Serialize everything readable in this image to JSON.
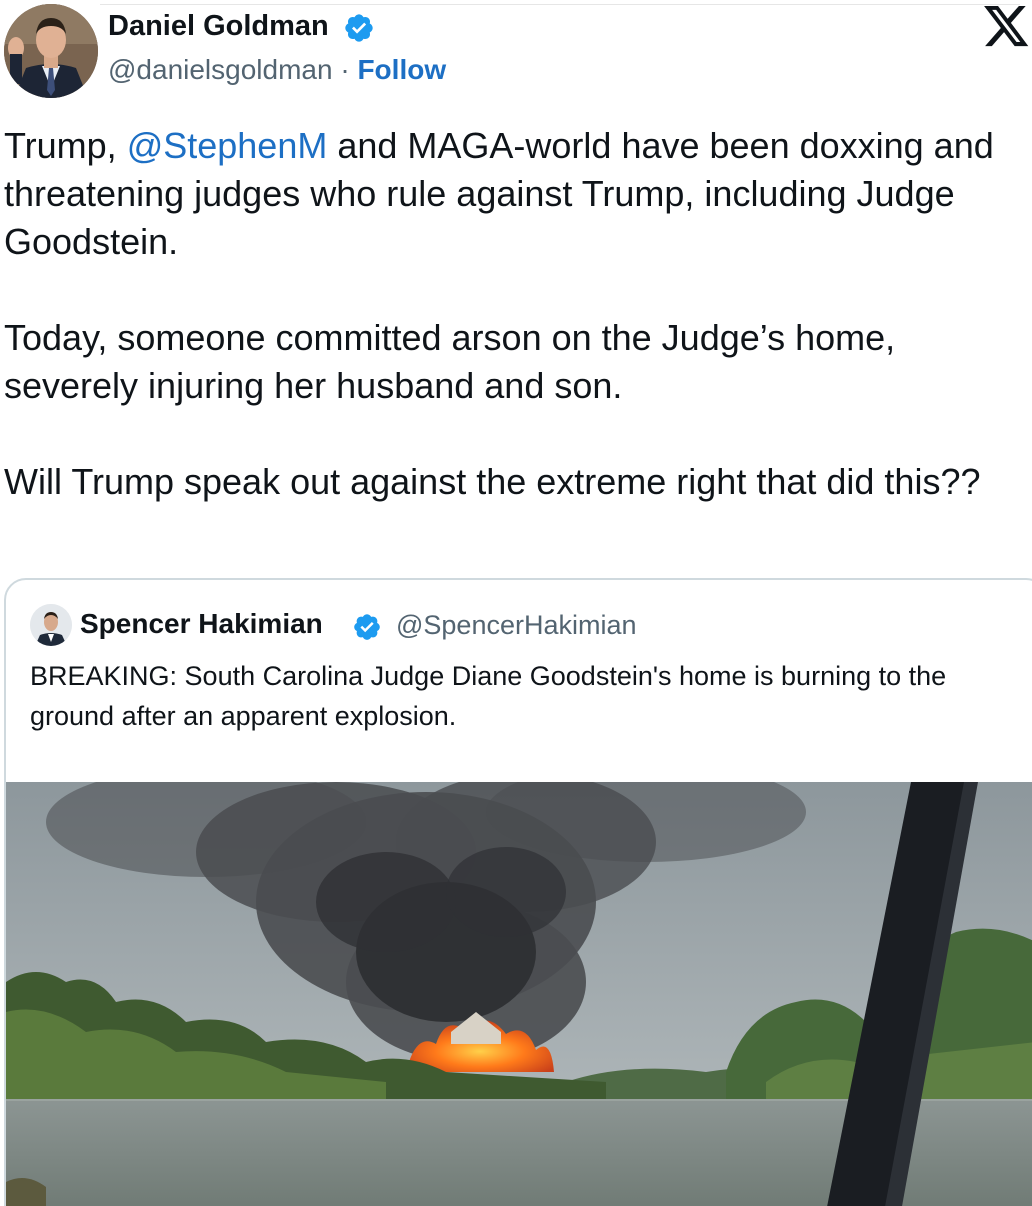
{
  "tweet": {
    "author": {
      "name": "Daniel Goldman",
      "handle": "@danielsgoldman",
      "separator": "·",
      "follow_label": "Follow"
    },
    "text": {
      "p1_pre": "Trump, ",
      "p1_mention": "@StephenM",
      "p1_post": " and MAGA-world have been doxxing and threatening judges who rule against Trump, including Judge Goodstein.",
      "p2": "Today, someone committed arson on the Judge’s home, severely injuring her husband and son.",
      "p3": "Will Trump speak out against the extreme right that did this??"
    }
  },
  "quoted_tweet": {
    "author": {
      "name": "Spencer Hakimian",
      "handle": "@SpencerHakimian"
    },
    "text": "BREAKING: South Carolina Judge Diane Goodstein's home is burning to the ground after an apparent explosion."
  },
  "icons": {
    "verified": "verified-badge-icon",
    "platform": "x-logo-icon"
  },
  "colors": {
    "link": "#1d6fc4",
    "verified": "#1d9bf0",
    "secondary_text": "#536471",
    "border": "#cfd9de"
  }
}
